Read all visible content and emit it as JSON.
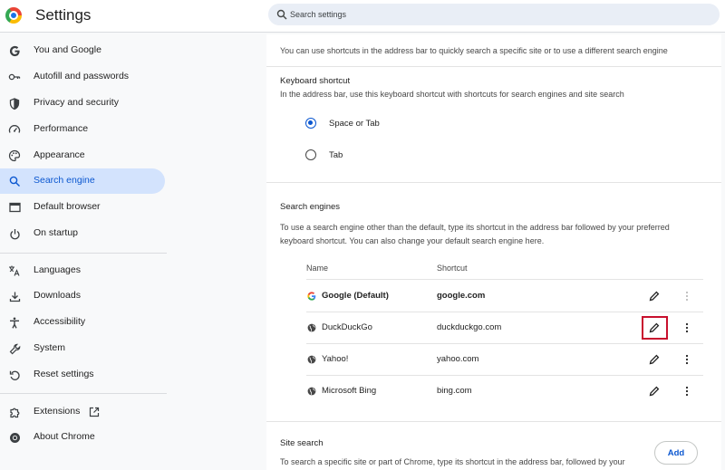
{
  "header": {
    "title": "Settings",
    "search_placeholder": "Search settings"
  },
  "sidebar": {
    "items": [
      {
        "label": "You and Google",
        "icon": "google-g-icon"
      },
      {
        "label": "Autofill and passwords",
        "icon": "key-icon"
      },
      {
        "label": "Privacy and security",
        "icon": "shield-icon"
      },
      {
        "label": "Performance",
        "icon": "speedometer-icon"
      },
      {
        "label": "Appearance",
        "icon": "palette-icon"
      },
      {
        "label": "Search engine",
        "icon": "search-icon",
        "active": true
      },
      {
        "label": "Default browser",
        "icon": "browser-window-icon"
      },
      {
        "label": "On startup",
        "icon": "power-icon"
      },
      {
        "label": "Languages",
        "icon": "translate-icon"
      },
      {
        "label": "Downloads",
        "icon": "download-icon"
      },
      {
        "label": "Accessibility",
        "icon": "accessibility-icon"
      },
      {
        "label": "System",
        "icon": "wrench-icon"
      },
      {
        "label": "Reset settings",
        "icon": "reset-icon"
      },
      {
        "label": "Extensions",
        "icon": "puzzle-icon",
        "external": true
      },
      {
        "label": "About Chrome",
        "icon": "chrome-icon"
      }
    ]
  },
  "main": {
    "intro": "You can use shortcuts in the address bar to quickly search a specific site or to use a different search engine",
    "keyboard_shortcut": {
      "title": "Keyboard shortcut",
      "description": "In the address bar, use this keyboard shortcut with shortcuts for search engines and site search",
      "options": [
        {
          "label": "Space or Tab",
          "selected": true
        },
        {
          "label": "Tab",
          "selected": false
        }
      ]
    },
    "search_engines": {
      "title": "Search engines",
      "description": "To use a search engine other than the default, type its shortcut in the address bar followed by your preferred keyboard shortcut. You can also change your default search engine here.",
      "columns": {
        "name": "Name",
        "shortcut": "Shortcut"
      },
      "rows": [
        {
          "name": "Google (Default)",
          "shortcut": "google.com",
          "icon": "google-g-icon",
          "default": true
        },
        {
          "name": "DuckDuckGo",
          "shortcut": "duckduckgo.com",
          "icon": "globe-icon",
          "highlighted": true
        },
        {
          "name": "Yahoo!",
          "shortcut": "yahoo.com",
          "icon": "globe-icon"
        },
        {
          "name": "Microsoft Bing",
          "shortcut": "bing.com",
          "icon": "globe-icon"
        }
      ]
    },
    "site_search": {
      "title": "Site search",
      "description": "To search a specific site or part of Chrome, type its shortcut in the address bar, followed by your",
      "add_label": "Add"
    },
    "colors": {
      "accent": "#0b57d0",
      "highlight_box": "#c8102e",
      "active_nav_bg": "#d3e3fd"
    }
  }
}
